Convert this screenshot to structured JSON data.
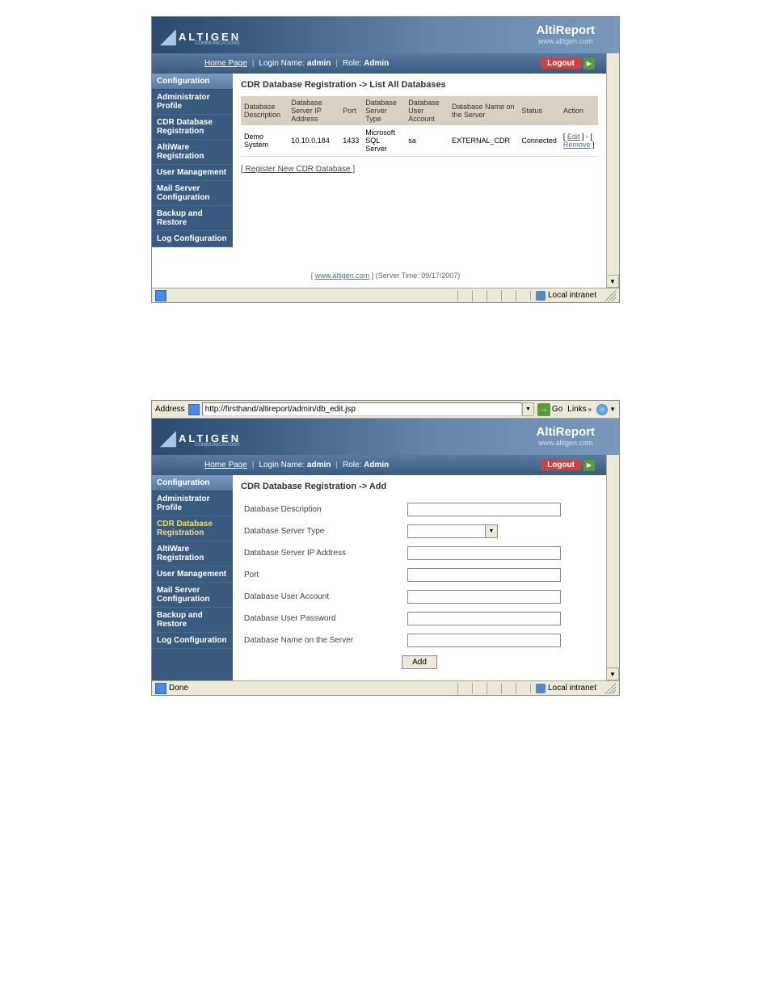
{
  "screenshot1": {
    "brand": {
      "title": "AltiReport",
      "url": "www.altigen.com",
      "logo": "ALTIGEN",
      "logo_sub": "COMMUNICATIONS"
    },
    "nav": {
      "home": "Home Page",
      "login_label": "Login Name:",
      "login_val": "admin",
      "role_label": "Role:",
      "role_val": "Admin",
      "logout": "Logout"
    },
    "sidebar": {
      "head": "Configuration",
      "items": [
        "Administrator Profile",
        "CDR Database Registration",
        "AltiWare Registration",
        "User Management",
        "Mail Server Configuration",
        "Backup and Restore",
        "Log Configuration"
      ]
    },
    "page_title": "CDR Database Registration -> List All Databases",
    "table": {
      "headers": [
        "Database Description",
        "Database Server IP Address",
        "Port",
        "Database Server Type",
        "Database User Account",
        "Database Name on the Server",
        "Status",
        "Action"
      ],
      "rows": [
        {
          "desc": "Demo System",
          "ip": "10.10.0.184",
          "port": "1433",
          "type": "Microsoft SQL Server",
          "user": "sa",
          "dbname": "EXTERNAL_CDR",
          "status": "Connected",
          "actions": {
            "edit": "Edit",
            "remove": "Remove"
          }
        }
      ]
    },
    "reg_link": "[ Register New CDR Database ]",
    "footer": {
      "link": "www.altigen.com",
      "server_time_lbl": "(Server Time: 09/17/2007)"
    },
    "status": {
      "zone": "Local intranet"
    }
  },
  "screenshot2": {
    "address_bar": {
      "label": "Address",
      "url": "http://firsthand/altireport/admin/db_edit.jsp",
      "go": "Go",
      "links": "Links"
    },
    "brand": {
      "title": "AltiReport",
      "url": "www.altigen.com",
      "logo": "ALTIGEN",
      "logo_sub": "COMMUNICATIONS"
    },
    "nav": {
      "home": "Home Page",
      "login_label": "Login Name:",
      "login_val": "admin",
      "role_label": "Role:",
      "role_val": "Admin",
      "logout": "Logout"
    },
    "sidebar": {
      "head": "Configuration",
      "items": [
        "Administrator Profile",
        "CDR Database Registration",
        "AltiWare Registration",
        "User Management",
        "Mail Server Configuration",
        "Backup and Restore",
        "Log Configuration"
      ]
    },
    "page_title": "CDR Database Registration -> Add",
    "form": {
      "fields": [
        {
          "label": "Database Description",
          "type": "text",
          "value": ""
        },
        {
          "label": "Database Server Type",
          "type": "select",
          "value": ""
        },
        {
          "label": "Database Server IP Address",
          "type": "text",
          "value": ""
        },
        {
          "label": "Port",
          "type": "text",
          "value": ""
        },
        {
          "label": "Database User Account",
          "type": "text",
          "value": ""
        },
        {
          "label": "Database User Password",
          "type": "text",
          "value": ""
        },
        {
          "label": "Database Name on the Server",
          "type": "text",
          "value": ""
        }
      ],
      "submit": "Add"
    },
    "status": {
      "done": "Done",
      "zone": "Local intranet"
    }
  }
}
